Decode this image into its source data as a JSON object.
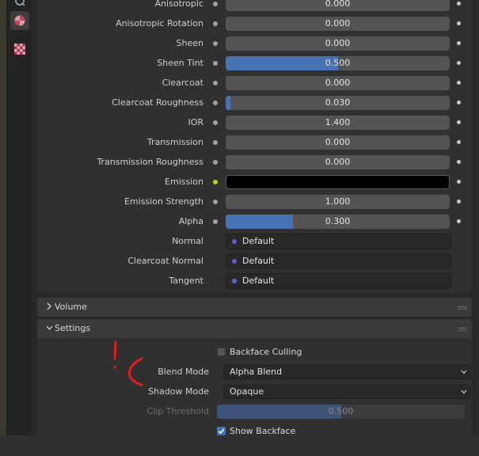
{
  "sidebar": {
    "tabs": [
      "world-tab",
      "material-tab",
      "texture-tab"
    ]
  },
  "properties": [
    {
      "label": "Anisotropic",
      "value": "0.000",
      "fill": 0
    },
    {
      "label": "Anisotropic Rotation",
      "value": "0.000",
      "fill": 0
    },
    {
      "label": "Sheen",
      "value": "0.000",
      "fill": 0
    },
    {
      "label": "Sheen Tint",
      "value": "0.500",
      "fill": 0.5
    },
    {
      "label": "Clearcoat",
      "value": "0.000",
      "fill": 0
    },
    {
      "label": "Clearcoat Roughness",
      "value": "0.030",
      "fill": 0.03
    },
    {
      "label": "IOR",
      "value": "1.400",
      "fill": 0
    },
    {
      "label": "Transmission",
      "value": "0.000",
      "fill": 0
    },
    {
      "label": "Transmission Roughness",
      "value": "0.000",
      "fill": 0
    },
    {
      "label": "Emission",
      "color": "#000000"
    },
    {
      "label": "Emission Strength",
      "value": "1.000",
      "fill": 0
    },
    {
      "label": "Alpha",
      "value": "0.300",
      "fill": 0.3
    },
    {
      "label": "Normal",
      "value": "Default",
      "vector": true
    },
    {
      "label": "Clearcoat Normal",
      "value": "Default",
      "vector": true
    },
    {
      "label": "Tangent",
      "value": "Default",
      "vector": true
    }
  ],
  "panels": {
    "volume": "Volume",
    "settings": "Settings"
  },
  "settings": {
    "backface_culling": {
      "label": "Backface Culling",
      "checked": false
    },
    "blend_mode": {
      "label": "Blend Mode",
      "value": "Alpha Blend"
    },
    "shadow_mode": {
      "label": "Shadow Mode",
      "value": "Opaque"
    },
    "clip_threshold": {
      "label": "Clip Threshold",
      "value": "0.500",
      "fill": 0.5
    },
    "show_backface": {
      "label": "Show Backface",
      "checked": true
    }
  },
  "colors": {
    "accent": "#4772b3",
    "float_socket": "#a1a1a1",
    "color_socket": "#c7c729",
    "vector_socket": "#6363c7",
    "annotation": "#e02020"
  }
}
